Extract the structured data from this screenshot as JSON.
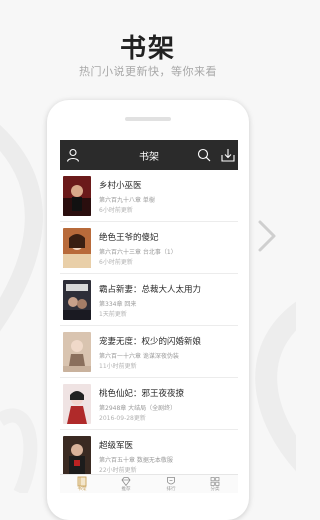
{
  "headline": "书架",
  "subhead": "热门小说更新快，等你来看",
  "app": {
    "title": "书架"
  },
  "books": [
    {
      "title": "乡村小巫医",
      "chapter": "第六百九十八章 单樹",
      "time": "6小时前更新"
    },
    {
      "title": "绝色王爷的傻妃",
      "chapter": "第六百六十三章 台北事（1）",
      "time": "6小时前更新"
    },
    {
      "title": "霸占新妻：总裁大人太用力",
      "chapter": "第334章 回来",
      "time": "1天前更新"
    },
    {
      "title": "宠妻无度：权少的闪婚新娘",
      "chapter": "第六百一十六章 诡谋深夜伪装",
      "time": "11小时前更新"
    },
    {
      "title": "桃色仙妃：邪王夜夜撩",
      "chapter": "第2948章 大结局（全剧终）",
      "time": "2016-09-28更新"
    },
    {
      "title": "超级军医",
      "chapter": "第六百五十章 数据无本敬服",
      "time": "22小时前更新"
    }
  ],
  "tabs": [
    {
      "label": "书架",
      "icon": "bookshelf-icon",
      "active": true
    },
    {
      "label": "推荐",
      "icon": "diamond-icon",
      "active": false
    },
    {
      "label": "排行",
      "icon": "ranking-icon",
      "active": false
    },
    {
      "label": "分类",
      "icon": "category-icon",
      "active": false
    }
  ],
  "colors": {
    "topbar": "#2b2b2b",
    "accent": "#c9a25a"
  }
}
